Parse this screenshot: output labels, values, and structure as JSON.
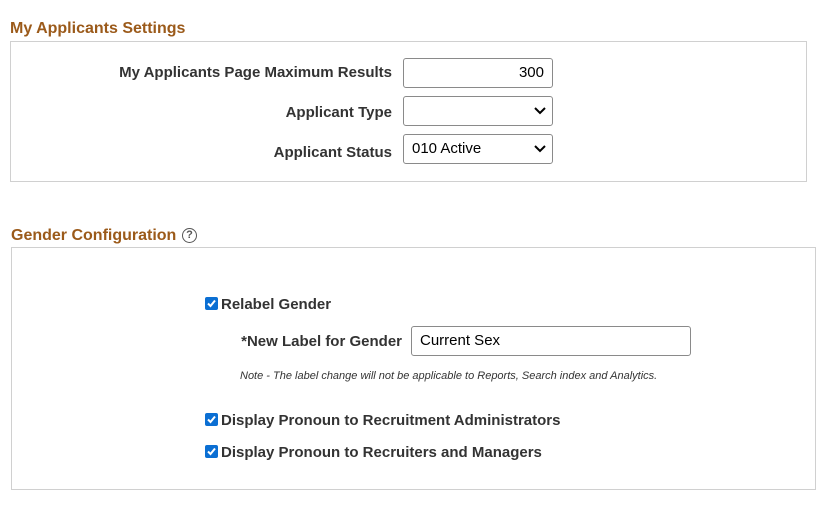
{
  "applicants": {
    "title": "My Applicants Settings",
    "max_results_label": "My Applicants Page Maximum Results",
    "max_results_value": "300",
    "type_label": "Applicant Type",
    "type_value": "",
    "status_label": "Applicant Status",
    "status_value": "010 Active"
  },
  "gender": {
    "title": "Gender Configuration",
    "help_icon": "?",
    "relabel_label": "Relabel Gender",
    "relabel_checked": true,
    "new_label_label": "*New Label for Gender",
    "new_label_value": "Current Sex",
    "note": "Note - The label change will not be applicable to Reports, Search index and Analytics.",
    "pronoun_admin_label": "Display Pronoun to Recruitment Administrators",
    "pronoun_admin_checked": true,
    "pronoun_recruiters_label": "Display Pronoun to Recruiters and Managers",
    "pronoun_recruiters_checked": true
  },
  "icons": {
    "help": "help-circle-icon",
    "check": "check-icon",
    "chevron": "chevron-down-icon"
  },
  "colors": {
    "section_title": "#9b5a1a",
    "checkbox": "#0b6fd3"
  }
}
